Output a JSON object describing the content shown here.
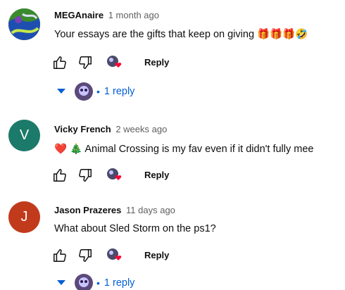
{
  "comments": [
    {
      "author": "MEGAnaire",
      "time": "1 month ago",
      "text": "Your essays are the gifts that keep on giving 🎁🎁🎁🤣",
      "avatar_icon": "abstract-avatar-icon",
      "reply_label": "Reply",
      "replies_label": "1 reply"
    },
    {
      "author": "Vicky French",
      "time": "2 weeks ago",
      "text": "❤️ 🎄 Animal Crossing is my fav even if it didn't fully mee",
      "avatar_letter": "V",
      "avatar_color": "#1c7a6a",
      "reply_label": "Reply"
    },
    {
      "author": "Jason Prazeres",
      "time": "11 days ago",
      "text": "What about Sled Storm on the ps1?",
      "avatar_letter": "J",
      "avatar_color": "#c23a1c",
      "reply_label": "Reply",
      "replies_label": "1 reply"
    }
  ],
  "colors": {
    "link_blue": "#065fd4",
    "muted_text": "#606060",
    "heart_red": "#ff0033"
  }
}
